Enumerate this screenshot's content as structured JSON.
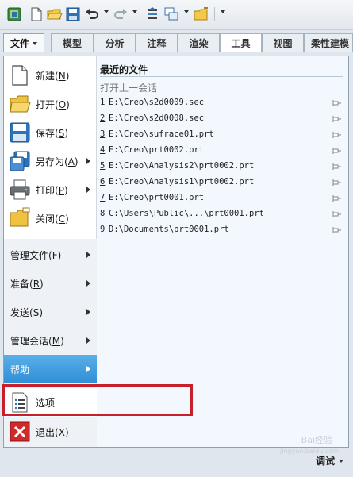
{
  "toolbar": {
    "icons": [
      "app-icon",
      "new-icon",
      "open-icon",
      "save-icon",
      "undo-icon",
      "redo-icon",
      "regenerate-icon",
      "windows-icon",
      "close-window-icon",
      "customize-icon"
    ]
  },
  "tabs": {
    "file": "文件",
    "items": [
      "模型",
      "分析",
      "注释",
      "渲染",
      "工具",
      "视图",
      "柔性建模"
    ],
    "active": "工具"
  },
  "file_menu": {
    "main_items": [
      {
        "label": "新建",
        "key": "N",
        "icon": "new-file-icon",
        "submenu": false
      },
      {
        "label": "打开",
        "key": "O",
        "icon": "open-folder-icon",
        "submenu": false
      },
      {
        "label": "保存",
        "key": "S",
        "icon": "save-disk-icon",
        "submenu": false
      },
      {
        "label": "另存为",
        "key": "A",
        "icon": "save-as-icon",
        "submenu": true
      },
      {
        "label": "打印",
        "key": "P",
        "icon": "printer-icon",
        "submenu": true
      },
      {
        "label": "关闭",
        "key": "C",
        "icon": "close-folder-icon",
        "submenu": false
      }
    ],
    "sub_items": [
      {
        "label": "管理文件",
        "key": "F"
      },
      {
        "label": "准备",
        "key": "R"
      },
      {
        "label": "发送",
        "key": "S"
      },
      {
        "label": "管理会话",
        "key": "M"
      }
    ],
    "help": {
      "label": "帮助"
    },
    "options": {
      "label": "选项",
      "icon": "options-list-icon"
    },
    "exit": {
      "label": "退出",
      "key": "X",
      "icon": "exit-x-icon"
    }
  },
  "recent": {
    "title": "最近的文件",
    "subtitle": "打开上一会话",
    "files": [
      {
        "num": "1",
        "path": "E:\\Creo\\s2d0009.sec"
      },
      {
        "num": "2",
        "path": "E:\\Creo\\s2d0008.sec"
      },
      {
        "num": "3",
        "path": "E:\\Creo\\sufrace01.prt"
      },
      {
        "num": "4",
        "path": "E:\\Creo\\prt0002.prt"
      },
      {
        "num": "5",
        "path": "E:\\Creo\\Analysis2\\prt0002.prt"
      },
      {
        "num": "6",
        "path": "E:\\Creo\\Analysis1\\prt0002.prt"
      },
      {
        "num": "7",
        "path": "E:\\Creo\\prt0001.prt"
      },
      {
        "num": "8",
        "path": "C:\\Users\\Public\\...\\prt0001.prt"
      },
      {
        "num": "9",
        "path": "D:\\Documents\\prt0001.prt"
      }
    ]
  },
  "status": {
    "debug": "调试"
  },
  "watermark": {
    "line1": "Bai经验",
    "line2": "jingyan.baidu.com"
  },
  "colors": {
    "highlight": "#3a9ae0",
    "annotation_box": "#c8202a",
    "panel_bg": "#f2f8fd"
  }
}
